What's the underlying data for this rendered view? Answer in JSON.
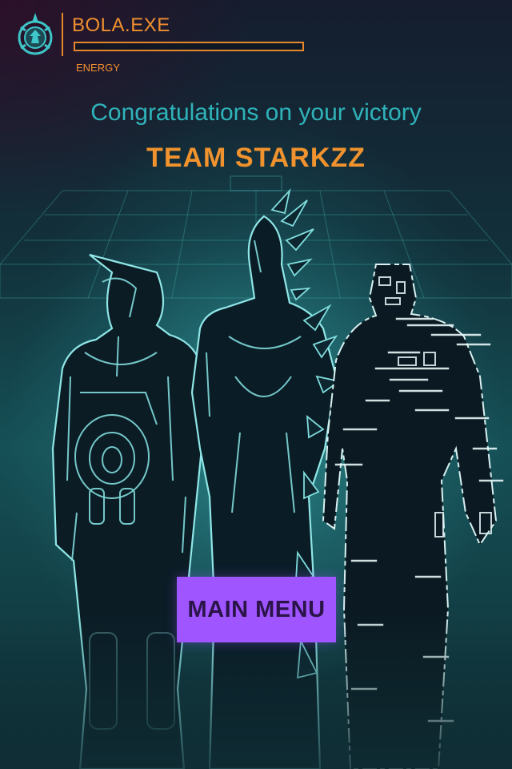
{
  "hud": {
    "player_name": "BOLA.EXE",
    "energy_label": "ENERGY",
    "energy_level": 0,
    "accent_color": "#e8862b",
    "logo_icon": "shield-emblem-icon"
  },
  "victory": {
    "message": "Congratulations on your victory",
    "team_name": "TEAM STARKZZ"
  },
  "actions": {
    "main_menu_label": "MAIN MENU",
    "button_color": "#9f55ff"
  },
  "scene": {
    "characters": [
      "robot-hero",
      "crystal-hero",
      "glitch-hero"
    ],
    "background": "holographic-grid-arena"
  }
}
